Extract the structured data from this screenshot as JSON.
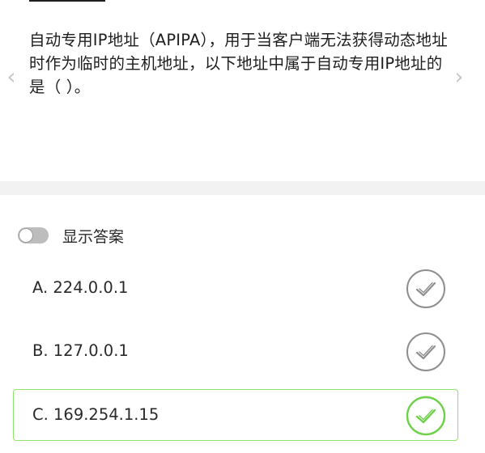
{
  "navigation": {
    "prev_arrow": "‹",
    "next_arrow": "›"
  },
  "question": {
    "text": "自动专用IP地址（APIPA），用于当客户端无法获得动态地址时作为临时的主机地址，以下地址中属于自动专用IP地址的是（ ）。"
  },
  "show_answer": {
    "label": "显示答案",
    "enabled": false
  },
  "options": [
    {
      "label": "A. 224.0.0.1",
      "correct": false
    },
    {
      "label": "B. 127.0.0.1",
      "correct": false
    },
    {
      "label": "C. 169.254.1.15",
      "correct": true
    }
  ],
  "colors": {
    "correct_accent": "#6ed14a",
    "neutral_icon": "#8f8f8f",
    "correct_border": "#8fe36b"
  }
}
